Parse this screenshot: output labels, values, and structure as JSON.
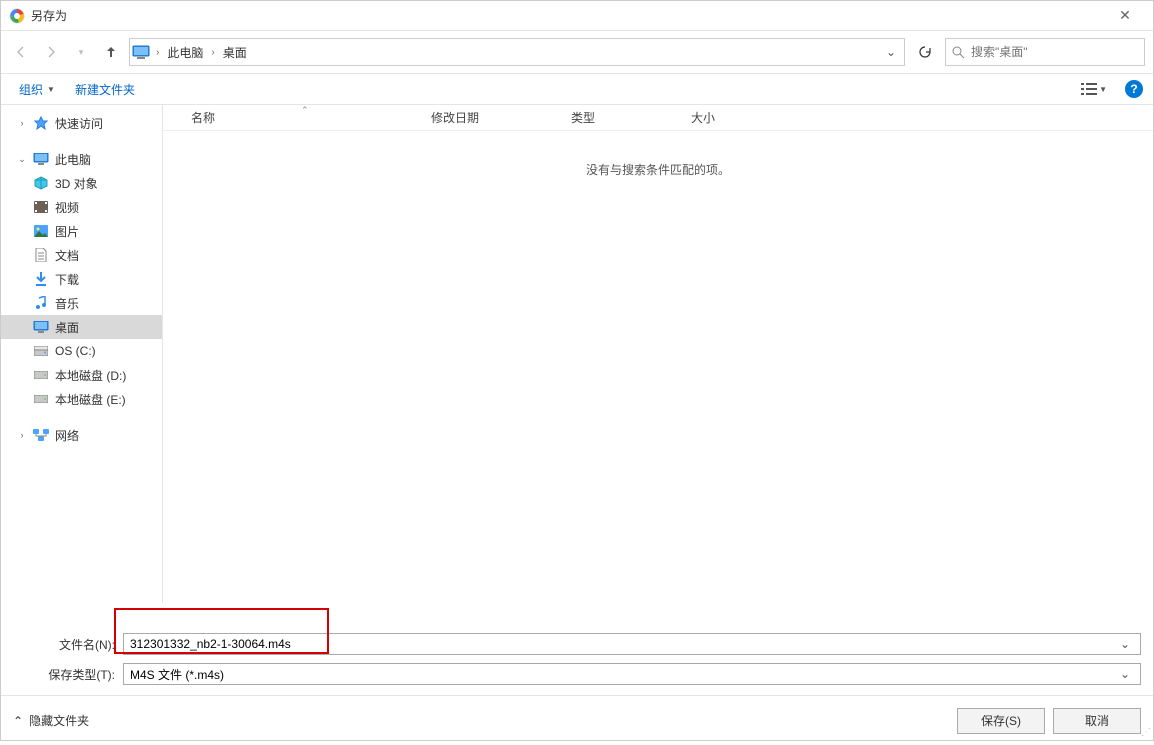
{
  "title": "另存为",
  "breadcrumb": {
    "root": "此电脑",
    "path": "桌面"
  },
  "search": {
    "placeholder": "搜索\"桌面\""
  },
  "toolbar": {
    "organize": "组织",
    "new_folder": "新建文件夹"
  },
  "columns": {
    "name": "名称",
    "date": "修改日期",
    "type": "类型",
    "size": "大小"
  },
  "empty_message": "没有与搜索条件匹配的项。",
  "sidebar": {
    "quick_access": "快速访问",
    "this_pc": "此电脑",
    "children": [
      {
        "label": "3D 对象"
      },
      {
        "label": "视频"
      },
      {
        "label": "图片"
      },
      {
        "label": "文档"
      },
      {
        "label": "下载"
      },
      {
        "label": "音乐"
      },
      {
        "label": "桌面",
        "selected": true
      },
      {
        "label": "OS (C:)"
      },
      {
        "label": "本地磁盘 (D:)"
      },
      {
        "label": "本地磁盘 (E:)"
      }
    ],
    "network": "网络"
  },
  "fields": {
    "filename_label": "文件名(N):",
    "filename_value": "312301332_nb2-1-30064.m4s",
    "filetype_label": "保存类型(T):",
    "filetype_value": "M4S 文件 (*.m4s)"
  },
  "footer": {
    "hide_folders": "隐藏文件夹",
    "save": "保存(S)",
    "cancel": "取消"
  }
}
